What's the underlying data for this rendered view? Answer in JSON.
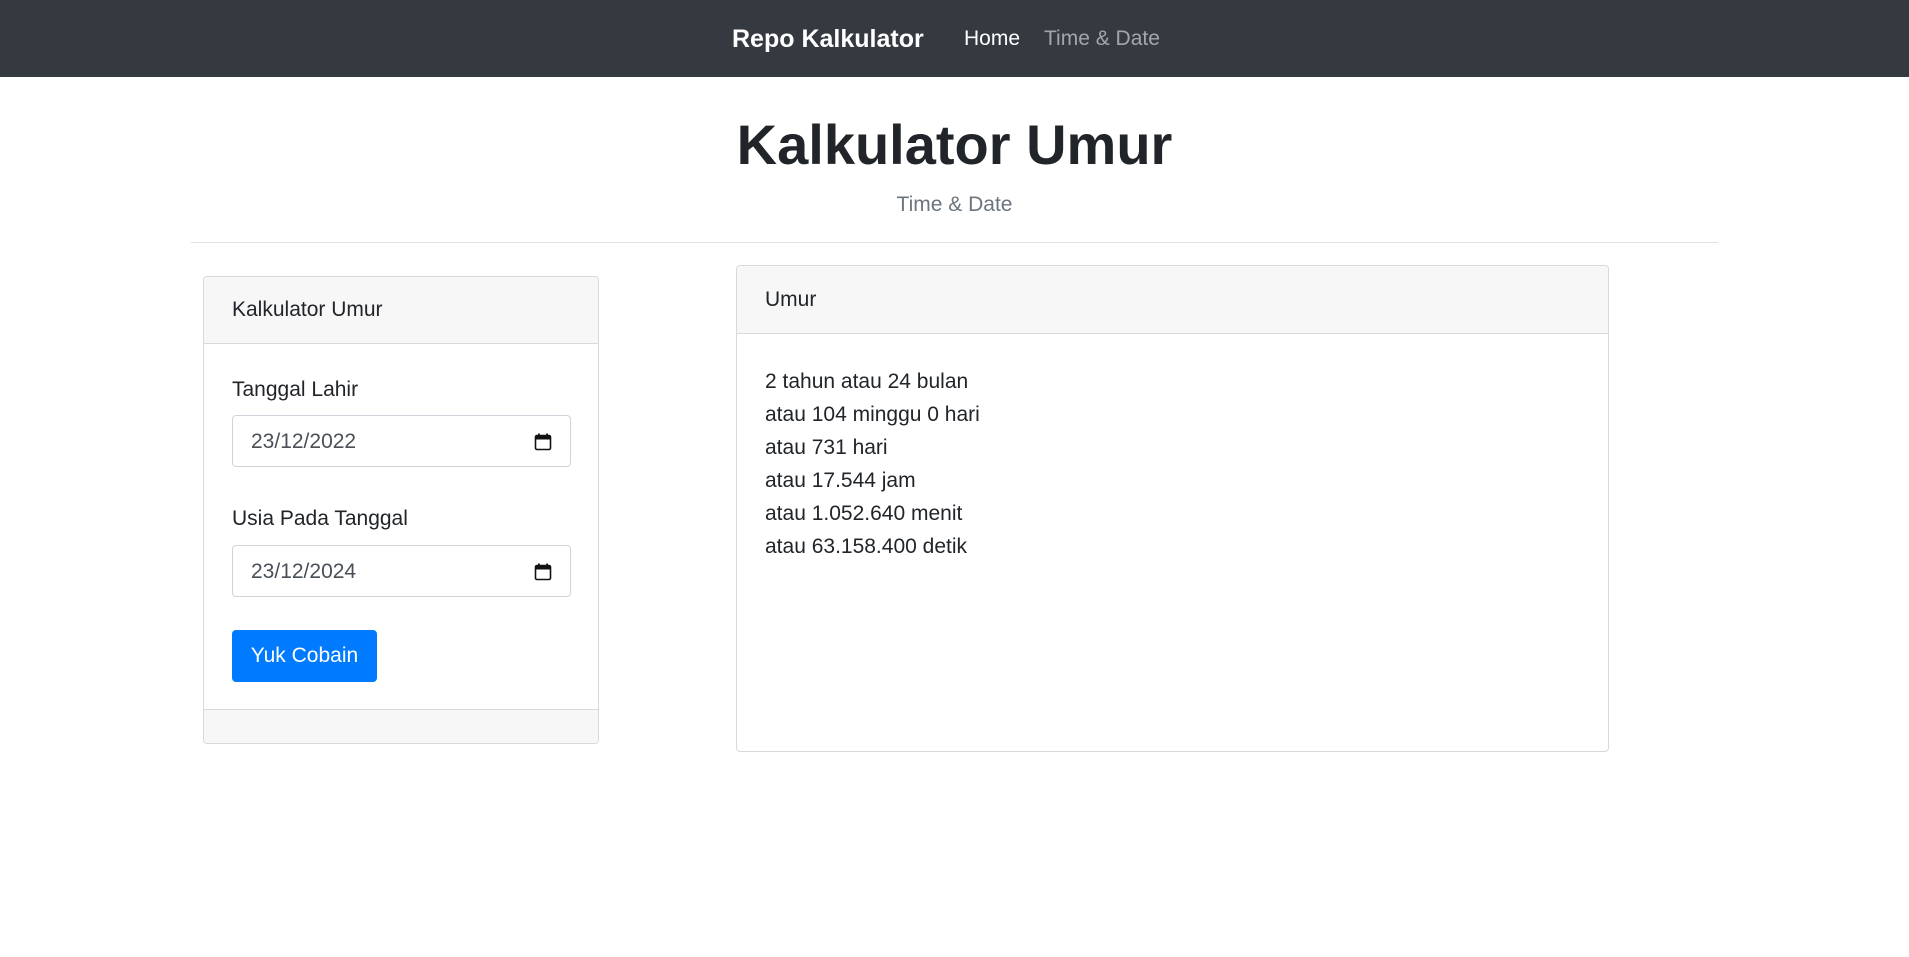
{
  "navbar": {
    "brand": "Repo Kalkulator",
    "links": [
      {
        "label": "Home",
        "active": true
      },
      {
        "label": "Time & Date",
        "active": false
      }
    ]
  },
  "header": {
    "title": "Kalkulator Umur",
    "subtitle": "Time & Date"
  },
  "form_card": {
    "header": "Kalkulator Umur",
    "birth_date": {
      "label": "Tanggal Lahir",
      "value": "23/12/2022"
    },
    "age_at_date": {
      "label": "Usia Pada Tanggal",
      "value": "23/12/2024"
    },
    "submit_label": "Yuk Cobain"
  },
  "result_card": {
    "header": "Umur",
    "lines": [
      "2 tahun atau 24 bulan",
      "atau 104 minggu 0 hari",
      "atau 731 hari",
      "atau 17.544 jam",
      "atau 1.052.640 menit",
      "atau 63.158.400 detik"
    ]
  },
  "colors": {
    "navbar_bg": "#343a40",
    "primary": "#007bff",
    "muted_text": "#6c757d",
    "card_header_bg": "#f7f7f7"
  },
  "icons": {
    "date_picker": "calendar-icon"
  }
}
